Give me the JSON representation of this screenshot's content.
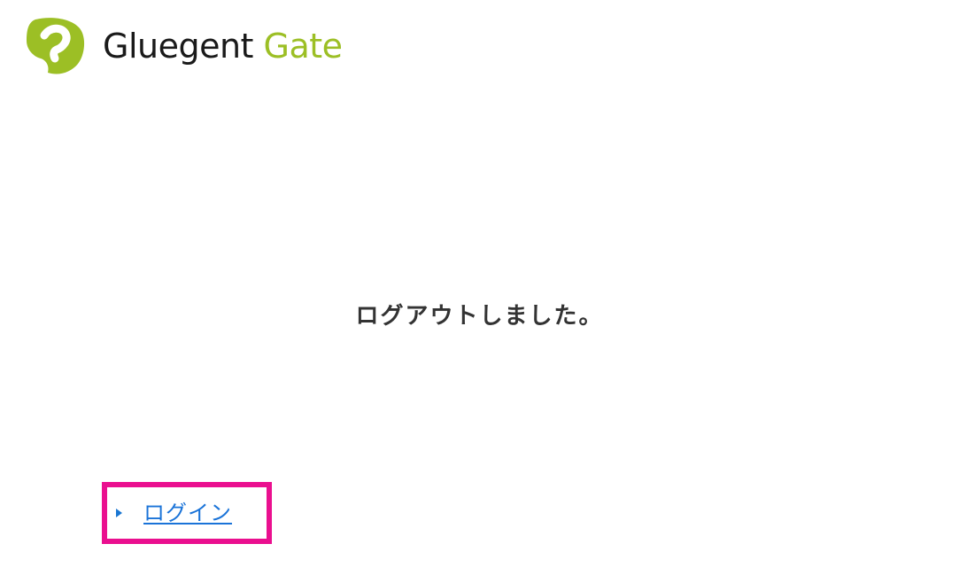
{
  "header": {
    "logo_icon": "gluegent-logo-icon",
    "brand_name_part1": "Gluegent",
    "brand_name_part2": " Gate",
    "brand_color_primary": "#1a1a1a",
    "brand_color_accent": "#9cbf25"
  },
  "main": {
    "message": "ログアウトしました。",
    "login_link_label": "ログイン",
    "link_icon": "triangle-right-icon",
    "link_color": "#1a73d8",
    "highlight_color": "#ea0f8f"
  }
}
